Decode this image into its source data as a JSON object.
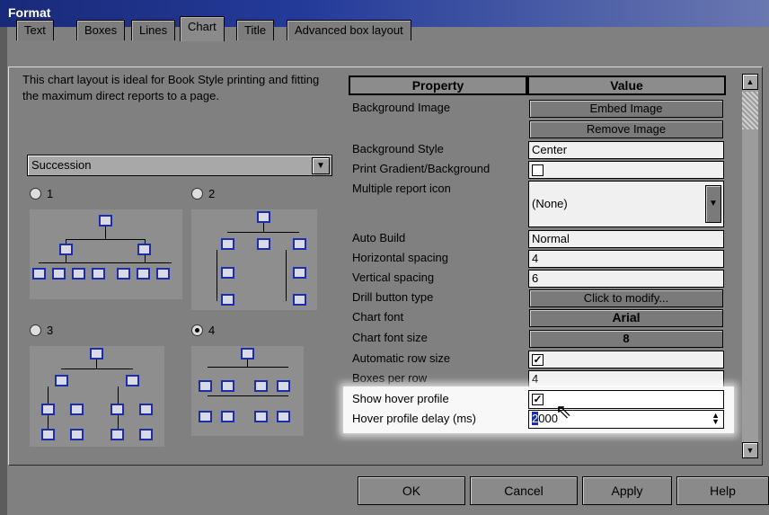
{
  "window": {
    "title": "Format"
  },
  "tabs": [
    "Text",
    "Boxes",
    "Lines",
    "Chart",
    "Title",
    "Advanced box layout"
  ],
  "active_tab": "Chart",
  "description": "This chart layout is ideal for Book Style printing and fitting the maximum direct reports to a page.",
  "layout_select": {
    "value": "Succession"
  },
  "layout_options": [
    {
      "label": "1",
      "selected": false
    },
    {
      "label": "2",
      "selected": false
    },
    {
      "label": "3",
      "selected": false
    },
    {
      "label": "4",
      "selected": true
    }
  ],
  "grid": {
    "headers": {
      "property": "Property",
      "value": "Value"
    },
    "rows": {
      "background_image": {
        "label": "Background Image",
        "embed": "Embed Image",
        "remove": "Remove Image"
      },
      "background_style": {
        "label": "Background Style",
        "value": "Center"
      },
      "print_gradient": {
        "label": "Print Gradient/Background",
        "checked": false
      },
      "multiple_report_icon": {
        "label": "Multiple report icon",
        "value": "(None)"
      },
      "auto_build": {
        "label": "Auto Build",
        "value": "Normal"
      },
      "horizontal_spacing": {
        "label": "Horizontal spacing",
        "value": "4"
      },
      "vertical_spacing": {
        "label": "Vertical spacing",
        "value": "6"
      },
      "drill_button_type": {
        "label": "Drill button type",
        "value": "Click to modify..."
      },
      "chart_font": {
        "label": "Chart font",
        "value": "Arial"
      },
      "chart_font_size": {
        "label": "Chart font size",
        "value": "8"
      },
      "automatic_row_size": {
        "label": "Automatic row size",
        "checked": true
      },
      "boxes_per_row": {
        "label": "Boxes per row",
        "value": "4"
      },
      "show_hover_profile": {
        "label": "Show hover profile",
        "checked": true
      },
      "hover_profile_delay": {
        "label": "Hover profile delay (ms)",
        "value_cursor": "2",
        "value_rest": "000"
      }
    }
  },
  "buttons": {
    "ok": "OK",
    "cancel": "Cancel",
    "apply": "Apply",
    "help": "Help"
  },
  "colors": {
    "title_bar": "#1a2a7a",
    "box_border": "#1b2ea8",
    "highlight": "#ffffff"
  }
}
